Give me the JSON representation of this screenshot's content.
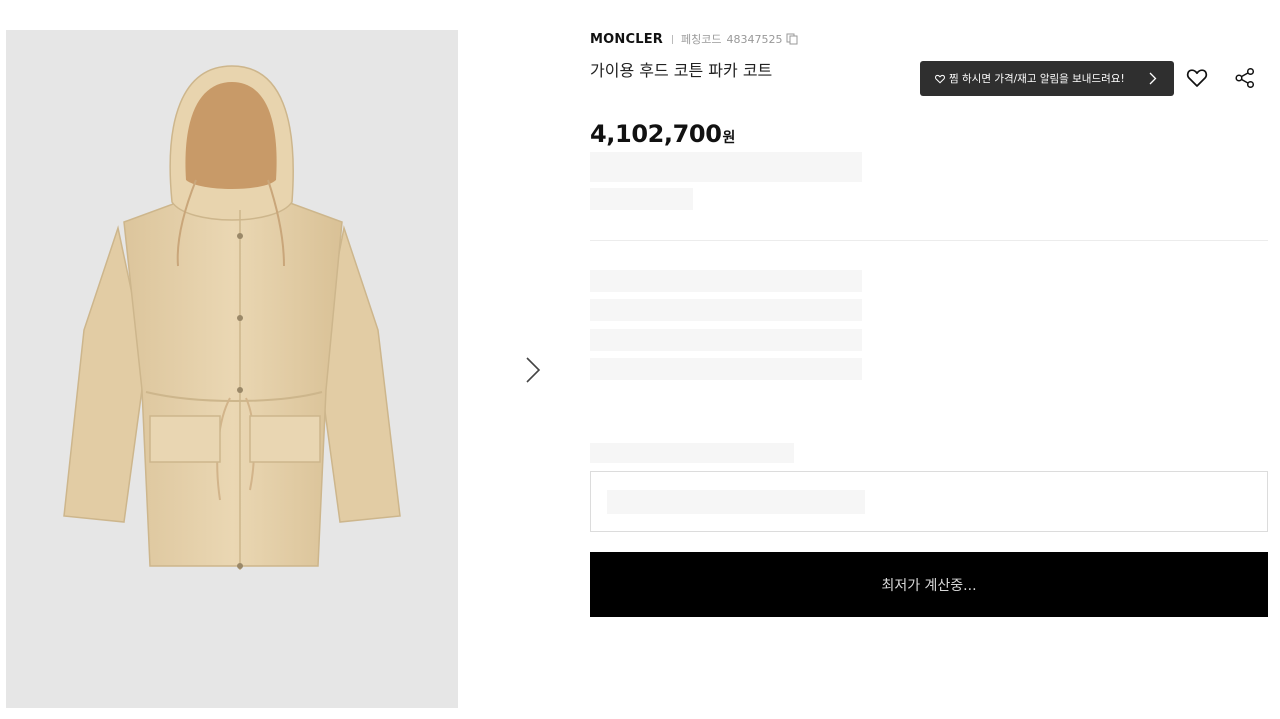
{
  "product": {
    "brand": "MONCLER",
    "code_label": "페칭코드",
    "code_value": "48347525",
    "title": "가이용 후드 코튼 파카 코트",
    "price_amount": "4,102,700",
    "price_unit": "원"
  },
  "alerts": {
    "notice_text": "찜 하시면 가격/재고 알림을 보내드려요!"
  },
  "purchase": {
    "button_label": "최저가 계산중..."
  },
  "icons": {
    "copy": "copy-icon",
    "next": "chevron-right-icon",
    "wishlist": "heart-icon",
    "share": "share-icon"
  },
  "colors": {
    "jacket": "#e7d3ae",
    "buy_button": "#000000",
    "notice_bg": "#2f2f2f"
  }
}
